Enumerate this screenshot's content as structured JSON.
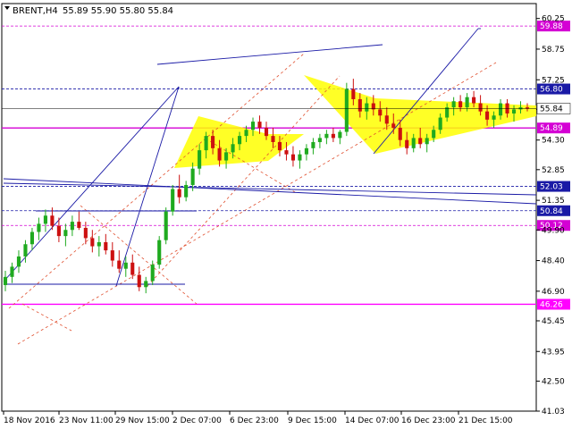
{
  "header": {
    "symbol": "BRENT,H4",
    "prices": "55.89 55.90 55.80 55.84"
  },
  "chart_data": {
    "type": "candlestick",
    "title": "BRENT,H4",
    "ylim": [
      41.03,
      60.98
    ],
    "y_ticks": [
      "60.25",
      "58.75",
      "57.25",
      "55.80",
      "54.30",
      "52.85",
      "51.35",
      "49.90",
      "48.40",
      "46.90",
      "45.45",
      "43.95",
      "42.50",
      "41.03"
    ],
    "x_tick_labels": [
      "18 Nov 2016",
      "23 Nov 11:00",
      "29 Nov 15:00",
      "2 Dec 07:00",
      "6 Dec 23:00",
      "9 Dec 15:00",
      "14 Dec 07:00",
      "16 Dec 23:00",
      "21 Dec 15:00"
    ],
    "current_price": "55.84",
    "levels": [
      {
        "label": "59.88",
        "value": 59.88,
        "color": "#d400d4",
        "style": "dashed"
      },
      {
        "label": "56.80",
        "value": 56.8,
        "color": "#1a1aa6",
        "style": "dashed"
      },
      {
        "label": "54.89",
        "value": 54.89,
        "color": "#d400d4",
        "style": "solid"
      },
      {
        "label": "52.03",
        "value": 52.03,
        "color": "#1a1aa6",
        "style": "dashed"
      },
      {
        "label": "50.84",
        "value": 50.84,
        "color": "#1a1aa6",
        "style": "dashed"
      },
      {
        "label": "50.12",
        "value": 50.12,
        "color": "#d400d4",
        "style": "dashed"
      },
      {
        "label": "46.26",
        "value": 46.26,
        "color": "#ff00ff",
        "style": "solid"
      }
    ],
    "candles": [
      {
        "o": 47.2,
        "h": 47.9,
        "l": 46.9,
        "c": 47.6
      },
      {
        "o": 47.6,
        "h": 48.3,
        "l": 47.3,
        "c": 48.1
      },
      {
        "o": 48.1,
        "h": 48.9,
        "l": 47.8,
        "c": 48.6
      },
      {
        "o": 48.6,
        "h": 49.4,
        "l": 48.3,
        "c": 49.2
      },
      {
        "o": 49.2,
        "h": 50.0,
        "l": 48.9,
        "c": 49.8
      },
      {
        "o": 49.8,
        "h": 50.5,
        "l": 49.4,
        "c": 50.2
      },
      {
        "o": 50.2,
        "h": 50.9,
        "l": 49.8,
        "c": 50.6
      },
      {
        "o": 50.6,
        "h": 51.0,
        "l": 49.9,
        "c": 50.1
      },
      {
        "o": 50.1,
        "h": 50.5,
        "l": 49.3,
        "c": 49.6
      },
      {
        "o": 49.6,
        "h": 50.2,
        "l": 49.1,
        "c": 49.9
      },
      {
        "o": 49.9,
        "h": 50.6,
        "l": 49.6,
        "c": 50.3
      },
      {
        "o": 50.3,
        "h": 50.8,
        "l": 49.9,
        "c": 50.0
      },
      {
        "o": 50.0,
        "h": 50.3,
        "l": 49.2,
        "c": 49.5
      },
      {
        "o": 49.5,
        "h": 49.9,
        "l": 48.8,
        "c": 49.1
      },
      {
        "o": 49.1,
        "h": 49.6,
        "l": 48.6,
        "c": 49.3
      },
      {
        "o": 49.3,
        "h": 49.7,
        "l": 48.7,
        "c": 48.9
      },
      {
        "o": 48.9,
        "h": 49.3,
        "l": 48.1,
        "c": 48.4
      },
      {
        "o": 48.4,
        "h": 48.9,
        "l": 47.8,
        "c": 48.0
      },
      {
        "o": 48.0,
        "h": 48.6,
        "l": 47.6,
        "c": 48.3
      },
      {
        "o": 48.3,
        "h": 48.7,
        "l": 47.5,
        "c": 47.7
      },
      {
        "o": 47.7,
        "h": 48.1,
        "l": 46.9,
        "c": 47.1
      },
      {
        "o": 47.1,
        "h": 47.6,
        "l": 46.8,
        "c": 47.4
      },
      {
        "o": 47.4,
        "h": 48.4,
        "l": 47.2,
        "c": 48.2
      },
      {
        "o": 48.2,
        "h": 49.6,
        "l": 48.0,
        "c": 49.4
      },
      {
        "o": 49.4,
        "h": 51.0,
        "l": 49.2,
        "c": 50.8
      },
      {
        "o": 50.8,
        "h": 52.1,
        "l": 50.6,
        "c": 51.9
      },
      {
        "o": 51.9,
        "h": 52.6,
        "l": 51.2,
        "c": 51.5
      },
      {
        "o": 51.5,
        "h": 52.3,
        "l": 51.3,
        "c": 52.1
      },
      {
        "o": 52.1,
        "h": 53.2,
        "l": 51.8,
        "c": 52.9
      },
      {
        "o": 52.9,
        "h": 54.1,
        "l": 52.6,
        "c": 53.8
      },
      {
        "o": 53.8,
        "h": 54.7,
        "l": 53.4,
        "c": 54.5
      },
      {
        "o": 54.5,
        "h": 54.8,
        "l": 53.6,
        "c": 53.9
      },
      {
        "o": 53.9,
        "h": 54.3,
        "l": 53.0,
        "c": 53.3
      },
      {
        "o": 53.3,
        "h": 53.9,
        "l": 52.9,
        "c": 53.7
      },
      {
        "o": 53.7,
        "h": 54.4,
        "l": 53.4,
        "c": 54.1
      },
      {
        "o": 54.1,
        "h": 54.7,
        "l": 53.8,
        "c": 54.5
      },
      {
        "o": 54.5,
        "h": 55.0,
        "l": 54.2,
        "c": 54.8
      },
      {
        "o": 54.8,
        "h": 55.4,
        "l": 54.5,
        "c": 55.2
      },
      {
        "o": 55.2,
        "h": 55.5,
        "l": 54.6,
        "c": 54.9
      },
      {
        "o": 54.9,
        "h": 55.2,
        "l": 54.3,
        "c": 54.5
      },
      {
        "o": 54.5,
        "h": 54.9,
        "l": 53.9,
        "c": 54.2
      },
      {
        "o": 54.2,
        "h": 54.5,
        "l": 53.5,
        "c": 53.8
      },
      {
        "o": 53.8,
        "h": 54.2,
        "l": 53.3,
        "c": 53.6
      },
      {
        "o": 53.6,
        "h": 54.0,
        "l": 53.0,
        "c": 53.3
      },
      {
        "o": 53.3,
        "h": 53.8,
        "l": 52.9,
        "c": 53.6
      },
      {
        "o": 53.6,
        "h": 54.1,
        "l": 53.3,
        "c": 53.9
      },
      {
        "o": 53.9,
        "h": 54.4,
        "l": 53.6,
        "c": 54.2
      },
      {
        "o": 54.2,
        "h": 54.6,
        "l": 53.9,
        "c": 54.4
      },
      {
        "o": 54.4,
        "h": 54.8,
        "l": 54.1,
        "c": 54.6
      },
      {
        "o": 54.6,
        "h": 54.9,
        "l": 54.2,
        "c": 54.4
      },
      {
        "o": 54.4,
        "h": 54.8,
        "l": 54.1,
        "c": 54.7
      },
      {
        "o": 54.7,
        "h": 57.1,
        "l": 54.5,
        "c": 56.8
      },
      {
        "o": 56.8,
        "h": 57.3,
        "l": 56.0,
        "c": 56.3
      },
      {
        "o": 56.3,
        "h": 56.6,
        "l": 55.4,
        "c": 55.7
      },
      {
        "o": 55.7,
        "h": 56.4,
        "l": 55.3,
        "c": 56.1
      },
      {
        "o": 56.1,
        "h": 56.5,
        "l": 55.5,
        "c": 55.8
      },
      {
        "o": 55.8,
        "h": 56.2,
        "l": 55.2,
        "c": 55.5
      },
      {
        "o": 55.5,
        "h": 55.9,
        "l": 54.8,
        "c": 55.1
      },
      {
        "o": 55.1,
        "h": 55.6,
        "l": 54.6,
        "c": 54.9
      },
      {
        "o": 54.9,
        "h": 55.3,
        "l": 54.0,
        "c": 54.3
      },
      {
        "o": 54.3,
        "h": 54.7,
        "l": 53.6,
        "c": 53.9
      },
      {
        "o": 53.9,
        "h": 54.6,
        "l": 53.7,
        "c": 54.4
      },
      {
        "o": 54.4,
        "h": 54.9,
        "l": 53.9,
        "c": 54.1
      },
      {
        "o": 54.1,
        "h": 54.6,
        "l": 53.7,
        "c": 54.4
      },
      {
        "o": 54.4,
        "h": 55.0,
        "l": 54.2,
        "c": 54.8
      },
      {
        "o": 54.8,
        "h": 55.6,
        "l": 54.6,
        "c": 55.4
      },
      {
        "o": 55.4,
        "h": 56.1,
        "l": 55.2,
        "c": 55.9
      },
      {
        "o": 55.9,
        "h": 56.4,
        "l": 55.5,
        "c": 56.2
      },
      {
        "o": 56.2,
        "h": 56.5,
        "l": 55.7,
        "c": 55.9
      },
      {
        "o": 55.9,
        "h": 56.6,
        "l": 55.7,
        "c": 56.4
      },
      {
        "o": 56.4,
        "h": 56.7,
        "l": 55.9,
        "c": 56.1
      },
      {
        "o": 56.1,
        "h": 56.5,
        "l": 55.5,
        "c": 55.7
      },
      {
        "o": 55.7,
        "h": 56.0,
        "l": 55.0,
        "c": 55.3
      },
      {
        "o": 55.3,
        "h": 55.7,
        "l": 54.9,
        "c": 55.5
      },
      {
        "o": 55.5,
        "h": 56.3,
        "l": 55.3,
        "c": 56.1
      },
      {
        "o": 56.1,
        "h": 56.3,
        "l": 55.4,
        "c": 55.6
      },
      {
        "o": 55.6,
        "h": 56.0,
        "l": 55.2,
        "c": 55.8
      },
      {
        "o": 55.8,
        "h": 56.2,
        "l": 55.6,
        "c": 55.9
      },
      {
        "o": 55.9,
        "h": 56.1,
        "l": 55.7,
        "c": 55.84
      }
    ],
    "price_line": {
      "label": "55.84",
      "value": 55.84
    }
  }
}
